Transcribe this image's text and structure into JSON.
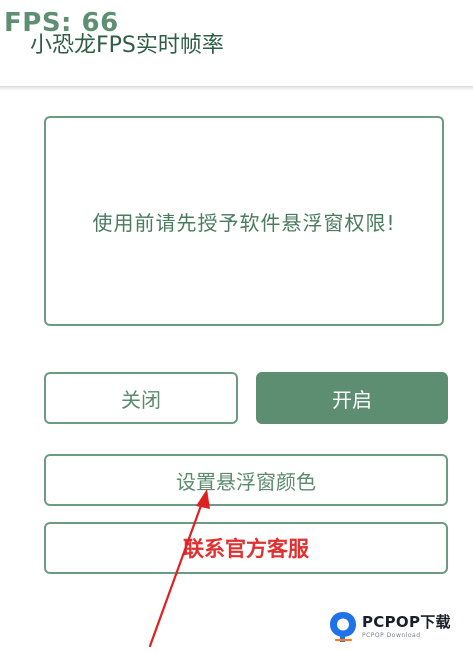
{
  "overlay": {
    "fps_text": "FPS: 66"
  },
  "header": {
    "title": "小恐龙FPS实时帧率"
  },
  "message": {
    "text": "使用前请先授予软件悬浮窗权限!"
  },
  "buttons": {
    "close_label": "关闭",
    "open_label": "开启",
    "set_color_label": "设置悬浮窗颜色",
    "contact_label": "联系官方客服"
  },
  "watermark": {
    "brand": "PCPOP下载",
    "tagline": "PCPOP Download"
  },
  "colors": {
    "accent": "#5e8e72",
    "border": "#6d9b82",
    "contact_text": "#e03030",
    "annotation_arrow": "#e02020"
  }
}
